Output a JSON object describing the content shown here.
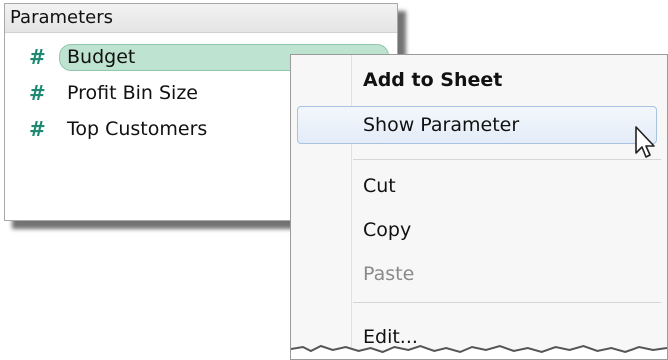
{
  "panel": {
    "title": "Parameters",
    "items": [
      {
        "icon": "hash-icon",
        "label": "Budget",
        "selected": true
      },
      {
        "icon": "hash-icon",
        "label": "Profit Bin Size",
        "selected": false
      },
      {
        "icon": "hash-icon",
        "label": "Top Customers",
        "selected": false
      }
    ],
    "hash_glyph": "#",
    "accent_color": "#1f8a72",
    "selected_fill": "#bfe3d1"
  },
  "context_menu": {
    "items": {
      "add_to_sheet": "Add to Sheet",
      "show_parameter": "Show Parameter",
      "cut": "Cut",
      "copy": "Copy",
      "paste": "Paste",
      "edit": "Edit..."
    },
    "hovered": "Show Parameter",
    "disabled": [
      "Paste"
    ]
  }
}
